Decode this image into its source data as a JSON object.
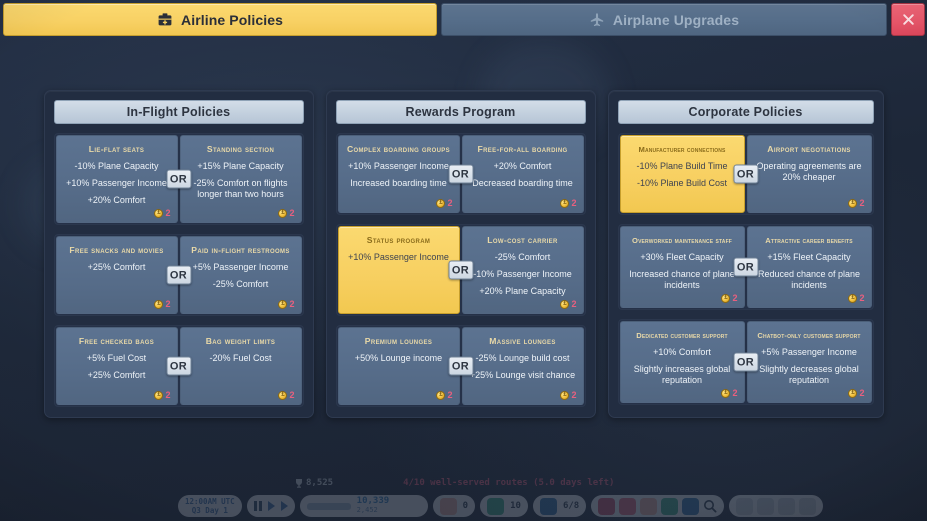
{
  "window": {
    "tabs": [
      {
        "label": "Airline Policies",
        "icon": "briefcase-medical-icon",
        "active": true
      },
      {
        "label": "Airplane Upgrades",
        "icon": "airplane-icon",
        "active": false
      }
    ],
    "close_label": "×",
    "close_icon": "close-icon",
    "accent_selected": "#f7cf60",
    "accent_card": "#566c89",
    "accent_close": "#e9566a",
    "cost_color": "#e8607f"
  },
  "or_label": "OR",
  "cost_currency_symbol": "£",
  "columns": [
    {
      "title": "In-Flight Policies",
      "rows": [
        {
          "left": {
            "title": "Lie-flat Seats",
            "effects": [
              "-10% Plane Capacity",
              "+10% Passenger Income",
              "+20% Comfort"
            ],
            "cost": "2",
            "selected": false
          },
          "right": {
            "title": "Standing Section",
            "effects": [
              "+15% Plane Capacity",
              "-25% Comfort on flights longer than two hours"
            ],
            "cost": "2",
            "selected": false
          }
        },
        {
          "left": {
            "title": "Free Snacks and Movies",
            "effects": [
              "+25% Comfort"
            ],
            "cost": "2",
            "selected": false
          },
          "right": {
            "title": "Paid In-Flight Restrooms",
            "effects": [
              "+5% Passenger Income",
              "-25% Comfort"
            ],
            "cost": "2",
            "selected": false
          }
        },
        {
          "left": {
            "title": "Free Checked Bags",
            "effects": [
              "+5% Fuel Cost",
              "+25% Comfort"
            ],
            "cost": "2",
            "selected": false
          },
          "right": {
            "title": "Bag Weight Limits",
            "effects": [
              "-20% Fuel Cost"
            ],
            "cost": "2",
            "selected": false
          }
        }
      ]
    },
    {
      "title": "Rewards Program",
      "rows": [
        {
          "left": {
            "title": "Complex Boarding Groups",
            "effects": [
              "+10% Passenger Income",
              "Increased boarding time"
            ],
            "cost": "2",
            "selected": false
          },
          "right": {
            "title": "Free-for-all Boarding",
            "effects": [
              "+20% Comfort",
              "Decreased boarding time"
            ],
            "cost": "2",
            "selected": false
          }
        },
        {
          "left": {
            "title": "Status Program",
            "effects": [
              "+10% Passenger Income"
            ],
            "cost": "",
            "selected": true
          },
          "right": {
            "title": "Low-Cost Carrier",
            "effects": [
              "-25% Comfort",
              "-10% Passenger Income",
              "+20% Plane Capacity"
            ],
            "cost": "2",
            "selected": false
          }
        },
        {
          "left": {
            "title": "Premium Lounges",
            "effects": [
              "+50% Lounge income"
            ],
            "cost": "2",
            "selected": false
          },
          "right": {
            "title": "Massive Lounges",
            "effects": [
              "-25% Lounge build cost",
              "+25% Lounge visit chance"
            ],
            "cost": "2",
            "selected": false
          }
        }
      ]
    },
    {
      "title": "Corporate Policies",
      "rows": [
        {
          "left": {
            "title": "Manufacturer Connections",
            "effects": [
              "-10% Plane Build Time",
              "-10% Plane Build Cost"
            ],
            "cost": "",
            "selected": true
          },
          "right": {
            "title": "Airport Negotiations",
            "effects": [
              "Operating agreements are 20% cheaper"
            ],
            "cost": "2",
            "selected": false
          }
        },
        {
          "left": {
            "title": "Overworked Maintenance Staff",
            "effects": [
              "+30% Fleet Capacity",
              "Increased chance of plane incidents"
            ],
            "cost": "2",
            "selected": false
          },
          "right": {
            "title": "Attractive Career benefits",
            "effects": [
              "+15% Fleet Capacity",
              "Reduced chance of plane incidents"
            ],
            "cost": "2",
            "selected": false
          }
        },
        {
          "left": {
            "title": "Dedicated Customer Support",
            "effects": [
              "+10% Comfort",
              "Slightly increases global reputation"
            ],
            "cost": "2",
            "selected": false
          },
          "right": {
            "title": "Chatbot-only Customer Support",
            "effects": [
              "+5% Passenger Income",
              "Slightly decreases global reputation"
            ],
            "cost": "2",
            "selected": false
          }
        }
      ]
    }
  ],
  "hud": {
    "score": "8,525",
    "score_icon": "trophy-icon",
    "routes_status": "4/10 well-served routes (5.0 days left)",
    "clock_time": "12:00AM UTC",
    "clock_date": "Q3 Day 1",
    "money": "10,339",
    "money_delta": "2,452",
    "cargo_count": "0",
    "world_count": "10",
    "mail_count": "6/8",
    "search_icon": "search-icon",
    "pause_icon": "pause-icon",
    "play_icon": "play-icon",
    "fastforward_icon": "fast-forward-icon"
  }
}
